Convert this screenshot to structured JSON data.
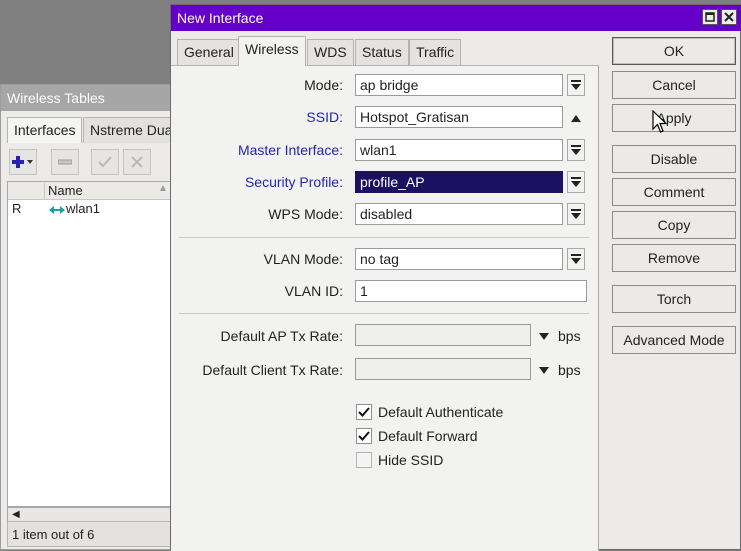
{
  "background_window": {
    "title": "Wireless Tables",
    "tabs": [
      "Interfaces",
      "Nstreme Dua"
    ],
    "table": {
      "columns": [
        "Name"
      ],
      "rows": [
        {
          "flag": "R",
          "name": "wlan1"
        }
      ]
    },
    "status": "1 item out of 6",
    "toolbar_icons": [
      "add-icon",
      "remove-icon",
      "enable-icon",
      "disable-icon"
    ]
  },
  "dialog": {
    "title": "New Interface",
    "title_color": "#6500c8",
    "tabs": [
      "General",
      "Wireless",
      "WDS",
      "Status",
      "Traffic"
    ],
    "active_tab": "Wireless",
    "fields": {
      "mode": {
        "label": "Mode:",
        "value": "ap bridge"
      },
      "ssid": {
        "label": "SSID:",
        "value": "Hotspot_Gratisan"
      },
      "master_interface": {
        "label": "Master Interface:",
        "value": "wlan1"
      },
      "security_profile": {
        "label": "Security Profile:",
        "value": "profile_AP"
      },
      "wps_mode": {
        "label": "WPS Mode:",
        "value": "disabled"
      },
      "vlan_mode": {
        "label": "VLAN Mode:",
        "value": "no tag"
      },
      "vlan_id": {
        "label": "VLAN ID:",
        "value": "1"
      },
      "default_ap_tx_rate": {
        "label": "Default AP Tx Rate:",
        "value": "",
        "unit": "bps"
      },
      "default_client_tx_rate": {
        "label": "Default Client Tx Rate:",
        "value": "",
        "unit": "bps"
      }
    },
    "checkboxes": [
      {
        "label": "Default Authenticate",
        "checked": true
      },
      {
        "label": "Default Forward",
        "checked": true
      },
      {
        "label": "Hide SSID",
        "checked": false
      }
    ],
    "buttons": [
      "OK",
      "Cancel",
      "Apply",
      "Disable",
      "Comment",
      "Copy",
      "Remove",
      "Torch",
      "Advanced Mode"
    ],
    "accent_label_color": "#2525b5",
    "selection_color": "#1c1060"
  }
}
